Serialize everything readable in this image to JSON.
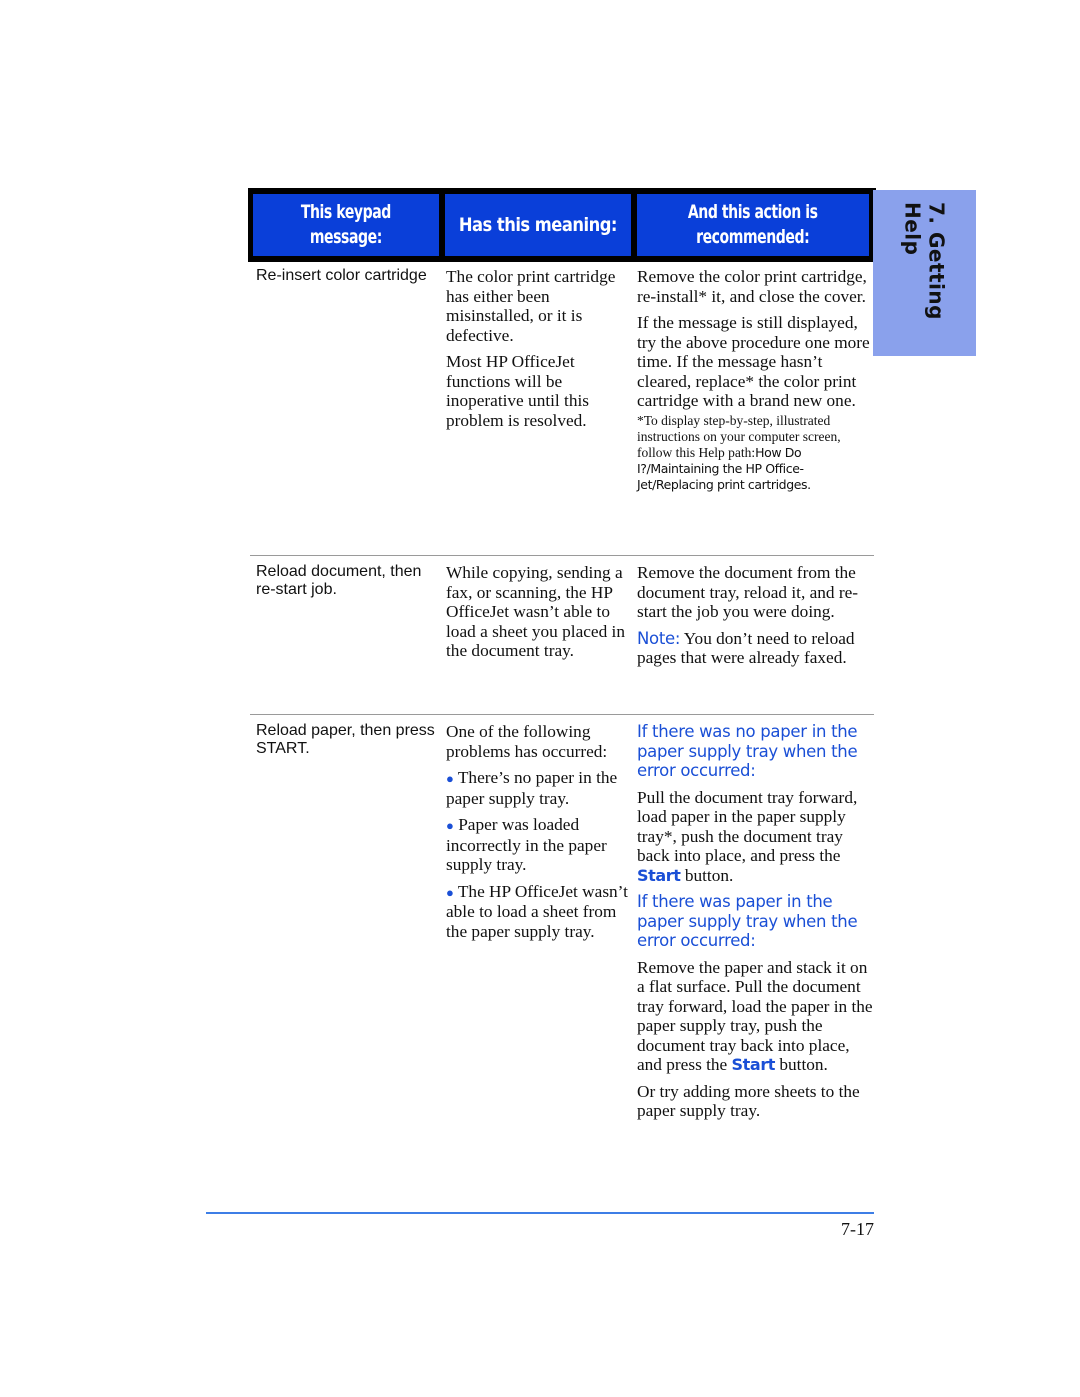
{
  "header": {
    "col1": [
      "This keypad",
      "message:"
    ],
    "col2": "Has this meaning:",
    "col3": [
      "And this action is",
      "recommended:"
    ]
  },
  "side_tab": {
    "label": "7. Getting Help",
    "color": "#8aa1ec"
  },
  "colors": {
    "header_blue": "#0a3fd9",
    "accent_blue": "#1a4fd6",
    "footer_rule": "#3d7ee6"
  },
  "rows": [
    {
      "message": "Re-insert color cartridge",
      "meaning": [
        "The color print cartridge has either been misinstalled, or it is defective.",
        "Most HP OfficeJet functions will be inoperative until this problem is resolved."
      ],
      "action": {
        "paragraphs": [
          "Remove the color print cartridge, re-install* it, and close the cover.",
          "If the message is still displayed, try the above procedure one more time. If the message hasn’t cleared, replace* the color print cartridge with a brand new one."
        ],
        "footnote_serif": "*To display step-by-step, illustrated instructions on your computer screen, follow this Help path:",
        "footnote_sans": "How Do I?/Maintaining the HP Office-Jet/Replacing print cartridges."
      }
    },
    {
      "message": "Reload document, then re-start job.",
      "meaning": [
        "While copying, sending a fax, or scanning, the HP OfficeJet wasn’t able to load a sheet you placed in the document tray."
      ],
      "action": {
        "paragraph": "Remove the document from the document tray, reload it, and re-start the job you were doing.",
        "note_label": "Note:",
        "note_text": " You don’t need to reload pages that were already faxed."
      }
    },
    {
      "message": "Reload paper, then press START.",
      "meaning_intro": "One of the following problems has occurred:",
      "meaning_bullets": [
        "There’s no paper in the paper supply tray.",
        "Paper was loaded incorrectly in the paper supply tray.",
        "The HP OfficeJet wasn’t able to load a sheet from the paper supply tray."
      ],
      "action": {
        "heading1": "If there was no paper in the paper supply tray when the error occurred:",
        "para1_before": "Pull the document tray forward, load paper in the paper supply tray*, push the document tray back into place, and press the ",
        "para1_start": "Start",
        "para1_after": " button.",
        "heading2": "If there was paper in the paper supply tray when the error occurred:",
        "para2_before": "Remove the paper and stack it on a flat surface. Pull the document tray forward, load the paper in the paper supply tray, push the document tray back into place, and press the ",
        "para2_start": "Start",
        "para2_after": " button.",
        "para3": "Or try adding more sheets to the paper supply tray."
      }
    }
  ],
  "footer": {
    "page_number": "7-17"
  }
}
